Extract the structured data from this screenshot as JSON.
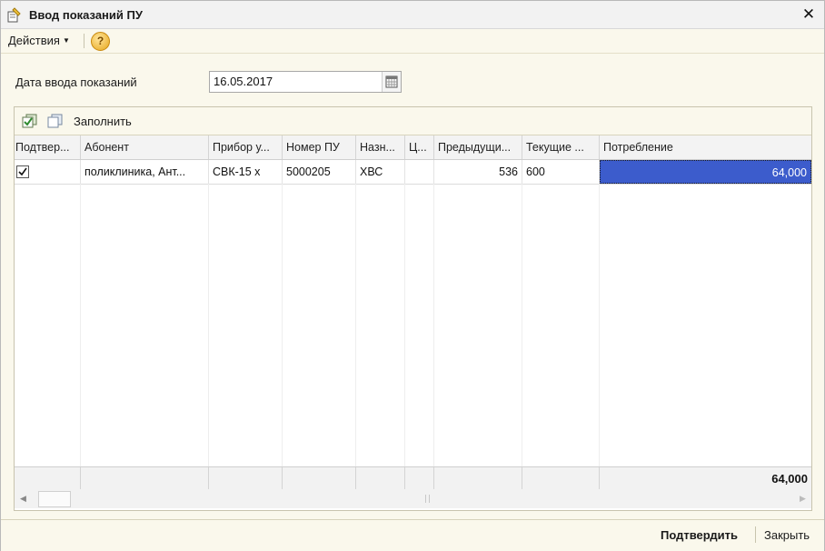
{
  "window": {
    "title": "Ввод показаний ПУ"
  },
  "menu": {
    "actions_label": "Действия",
    "help_label": "?"
  },
  "form": {
    "date_label": "Дата ввода показаний",
    "date_value": "16.05.2017"
  },
  "table_toolbar": {
    "fill_label": "Заполнить"
  },
  "table": {
    "columns": [
      "Подтвер...",
      "Абонент",
      "Прибор у...",
      "Номер ПУ",
      "Назн...",
      "Ц...",
      "Предыдущи...",
      "Текущие ...",
      "Потребление"
    ],
    "rows": [
      {
        "confirmed": true,
        "subscriber": "поликлиника, Ант...",
        "meter": "СВК-15 х",
        "meter_number": "5000205",
        "purpose": "ХВС",
        "price": "",
        "previous": "536",
        "current": "600",
        "consumption": "64,000"
      }
    ],
    "footer_total": "64,000"
  },
  "bottom": {
    "confirm_label": "Подтвердить",
    "close_label": "Закрыть"
  },
  "colors": {
    "selection": "#3c5ccc",
    "panel": "#faf8ec"
  }
}
